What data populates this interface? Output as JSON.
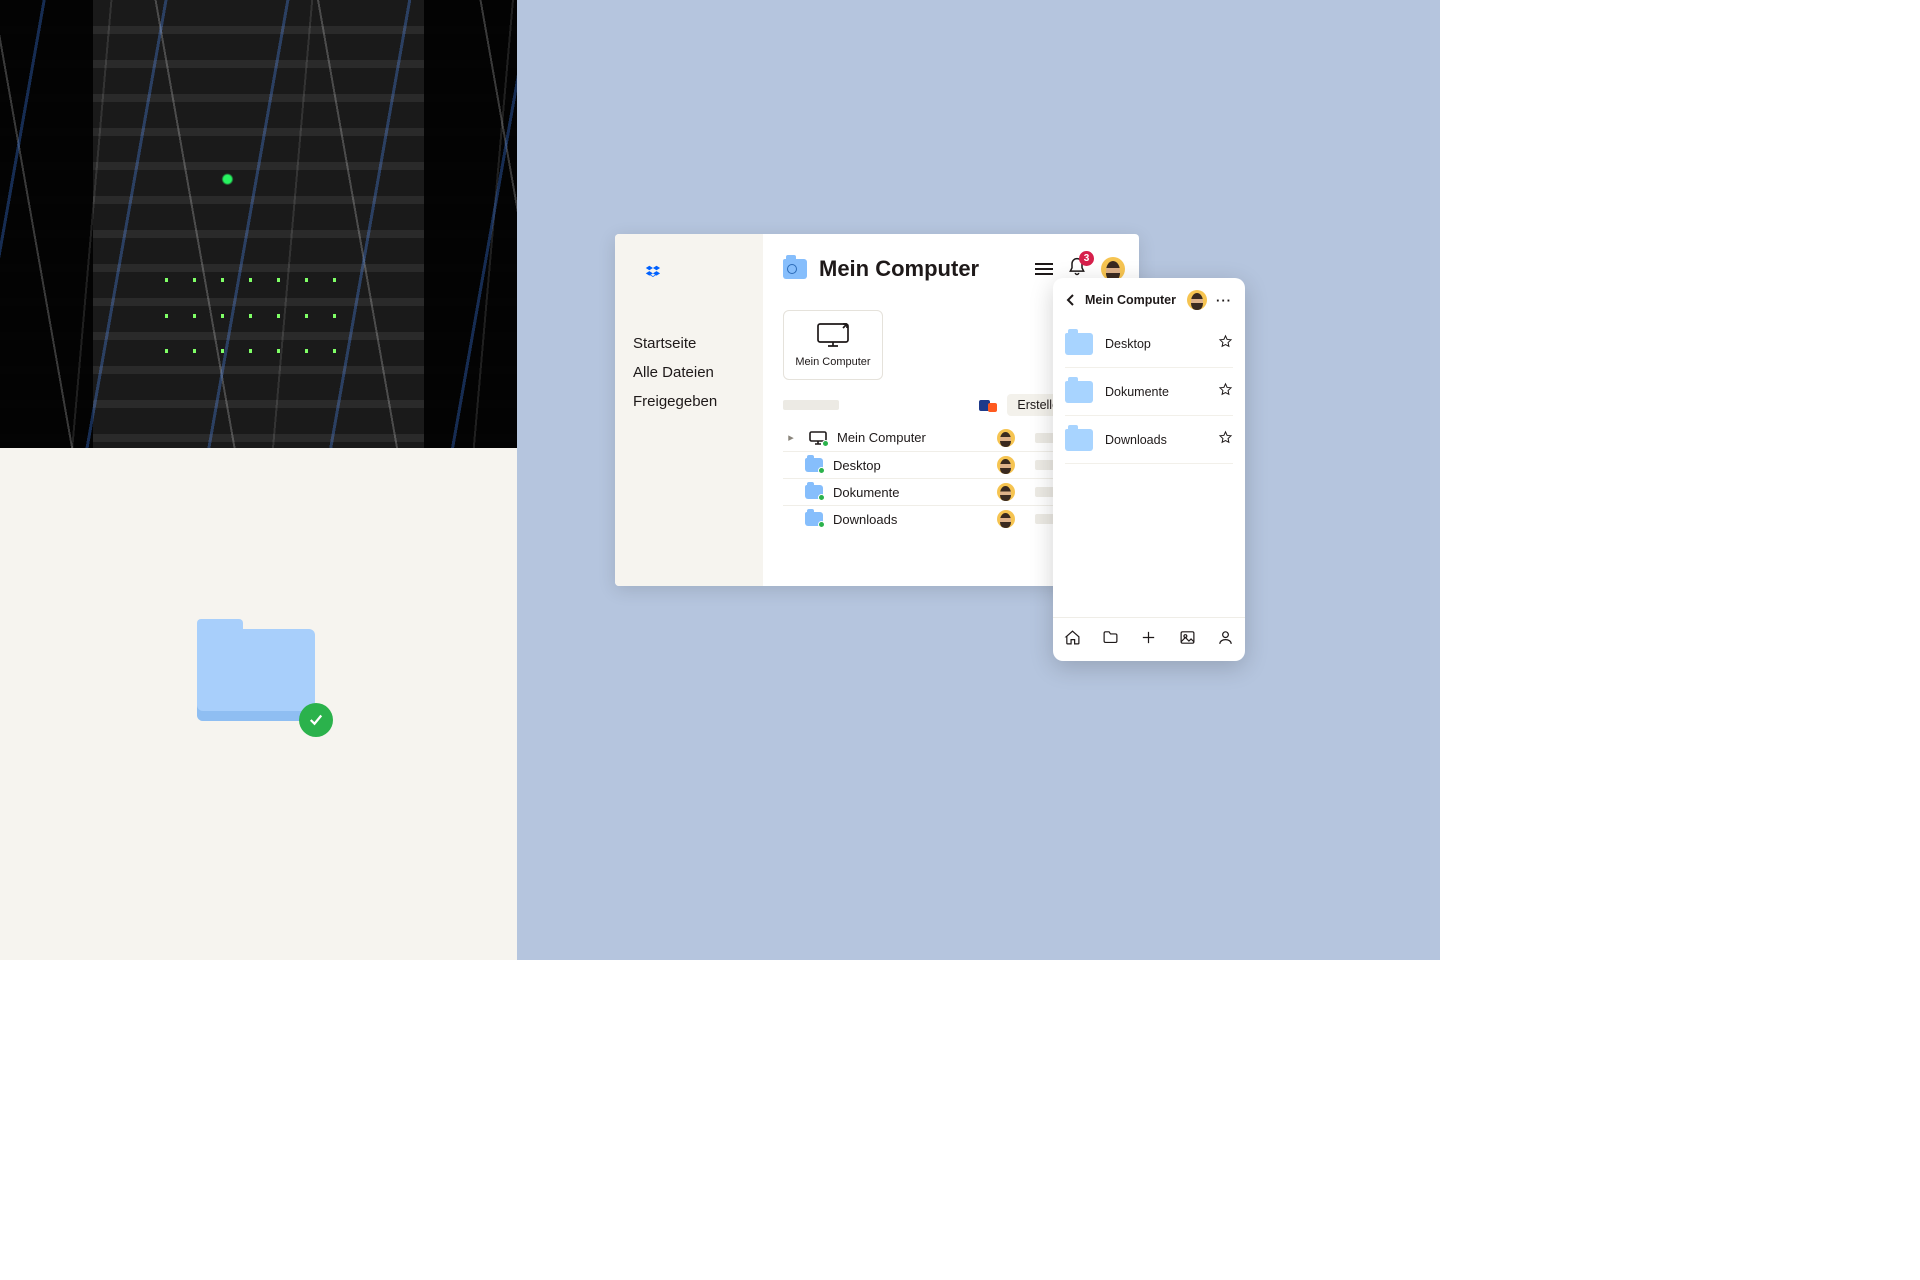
{
  "colors": {
    "accent": "#0061ff",
    "folder": "#a8cffb",
    "success": "#2bb24c",
    "badge": "#d6204b",
    "page_bg": "#b5c5de"
  },
  "left_panel": {
    "photo_subject": "server-rack-cables",
    "folder_status_icon": "checkmark-circle"
  },
  "desktop": {
    "page_title": "Mein Computer",
    "notification_count": "3",
    "sidebar": {
      "items": [
        {
          "label": "Startseite"
        },
        {
          "label": "Alle Dateien"
        },
        {
          "label": "Freigegeben"
        }
      ]
    },
    "device_card": {
      "label": "Mein Computer"
    },
    "create_button": "Erstellen",
    "rows": [
      {
        "name": "Mein Computer",
        "kind": "computer",
        "synced": true
      },
      {
        "name": "Desktop",
        "kind": "folder",
        "synced": true
      },
      {
        "name": "Dokumente",
        "kind": "folder",
        "synced": true
      },
      {
        "name": "Downloads",
        "kind": "folder",
        "synced": true
      }
    ]
  },
  "mobile": {
    "title": "Mein Computer",
    "rows": [
      {
        "name": "Desktop"
      },
      {
        "name": "Dokumente"
      },
      {
        "name": "Downloads"
      }
    ],
    "tabs": [
      "home-icon",
      "folder-icon",
      "plus-icon",
      "photo-icon",
      "person-icon"
    ]
  }
}
